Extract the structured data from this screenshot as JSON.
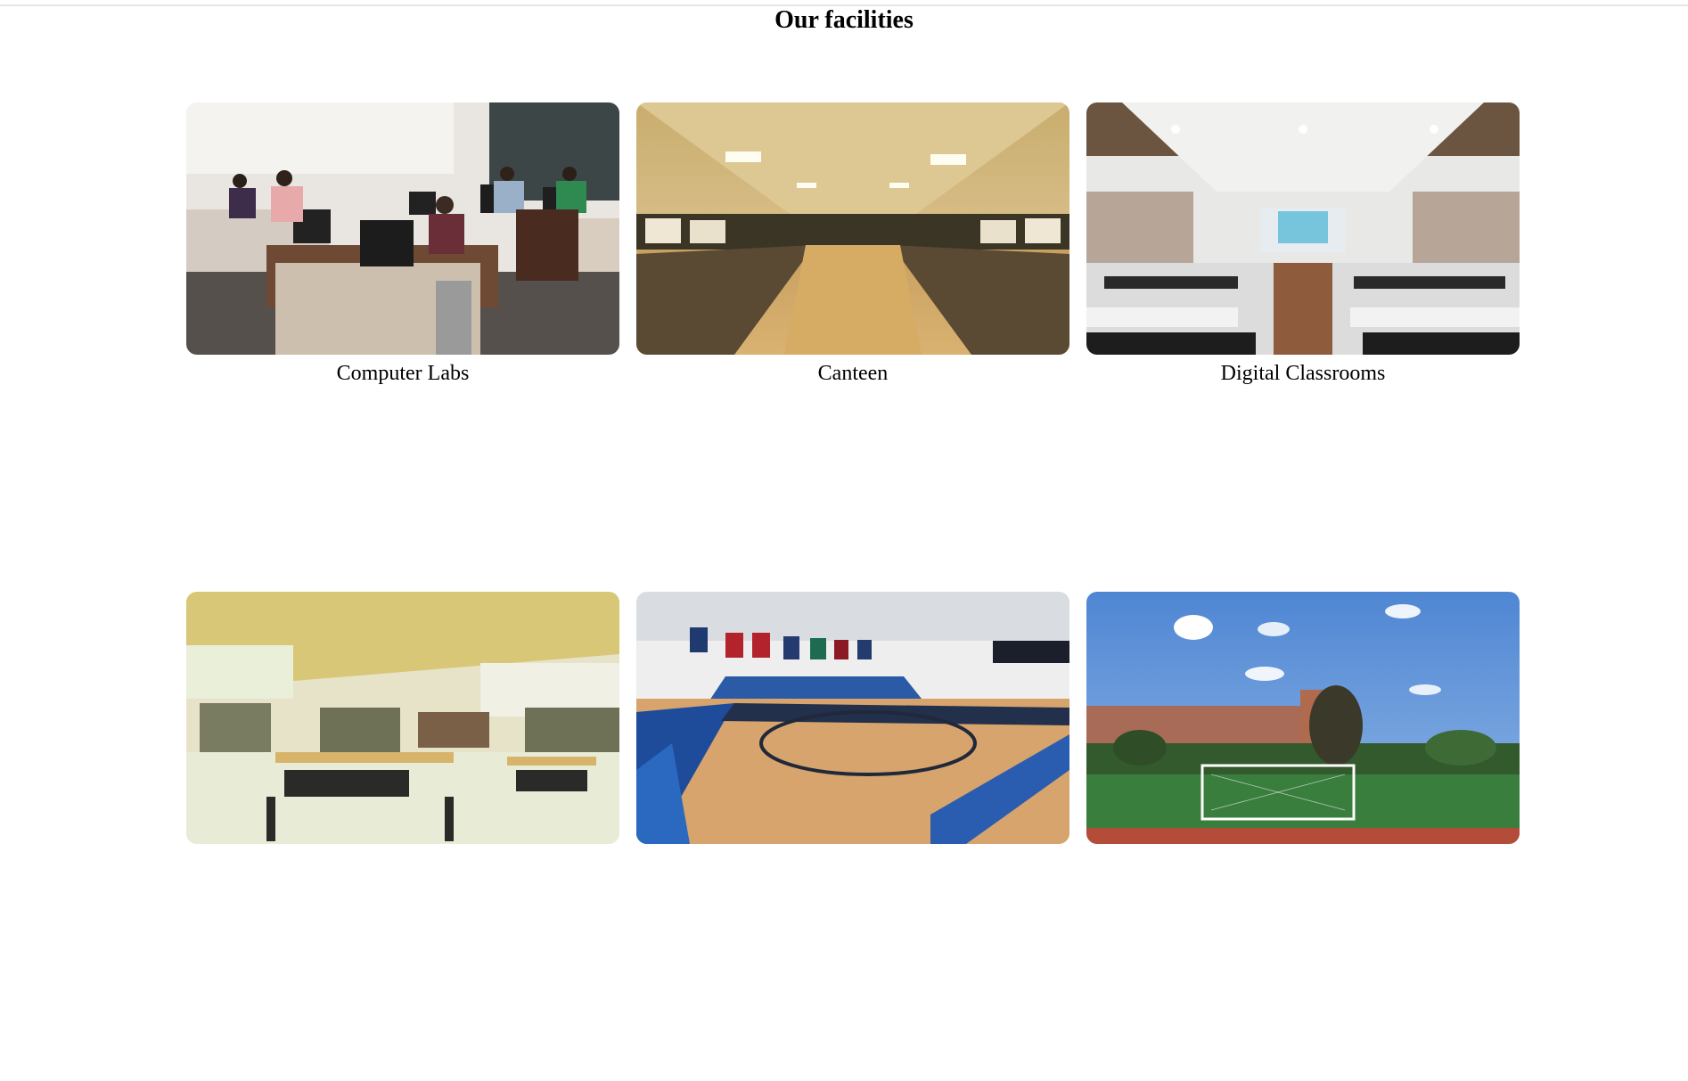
{
  "section": {
    "title": "Our facilities"
  },
  "facilities": [
    {
      "label": "Computer Labs",
      "image": "computer-lab-photo"
    },
    {
      "label": "Canteen",
      "image": "canteen-photo"
    },
    {
      "label": "Digital Classrooms",
      "image": "digital-classroom-photo"
    },
    {
      "label": "",
      "image": "library-photo"
    },
    {
      "label": "",
      "image": "basketball-court-photo"
    },
    {
      "label": "",
      "image": "sports-field-photo"
    }
  ]
}
